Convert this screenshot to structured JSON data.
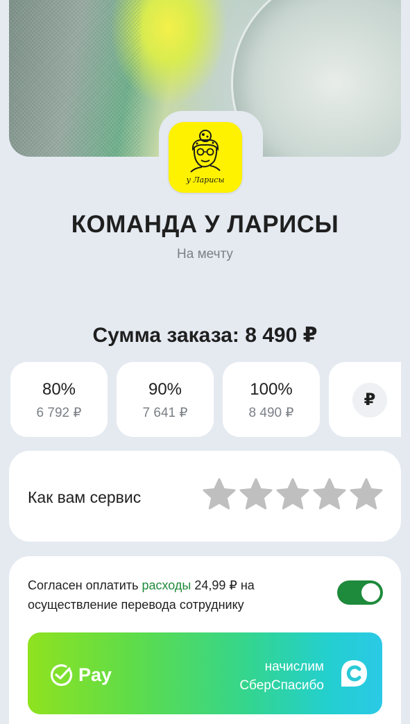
{
  "venue": {
    "name": "КОМАНДА У ЛАРИСЫ",
    "purpose": "На мечту",
    "logo_text": "у Ларисы"
  },
  "order": {
    "total_label": "Сумма заказа: 8 490 ₽"
  },
  "tips": [
    {
      "percent": "80%",
      "amount": "6 792 ₽"
    },
    {
      "percent": "90%",
      "amount": "7 641 ₽"
    },
    {
      "percent": "100%",
      "amount": "8 490 ₽"
    }
  ],
  "custom_tip_symbol": "₽",
  "rating": {
    "label": "Как вам сервис",
    "max": 5,
    "value": 0
  },
  "consent": {
    "prefix": "Согласен оплатить ",
    "link": "расходы",
    "suffix": " 24,99 ₽ на осуществление перевода сотруднику",
    "enabled": true
  },
  "pay_button": {
    "label": "Pay",
    "bonus_line1": "начислим",
    "bonus_line2": "СберСпасибо"
  },
  "colors": {
    "accent_green": "#1e8a3c",
    "star_empty": "#bfbfbf",
    "logo_yellow": "#fff200"
  }
}
